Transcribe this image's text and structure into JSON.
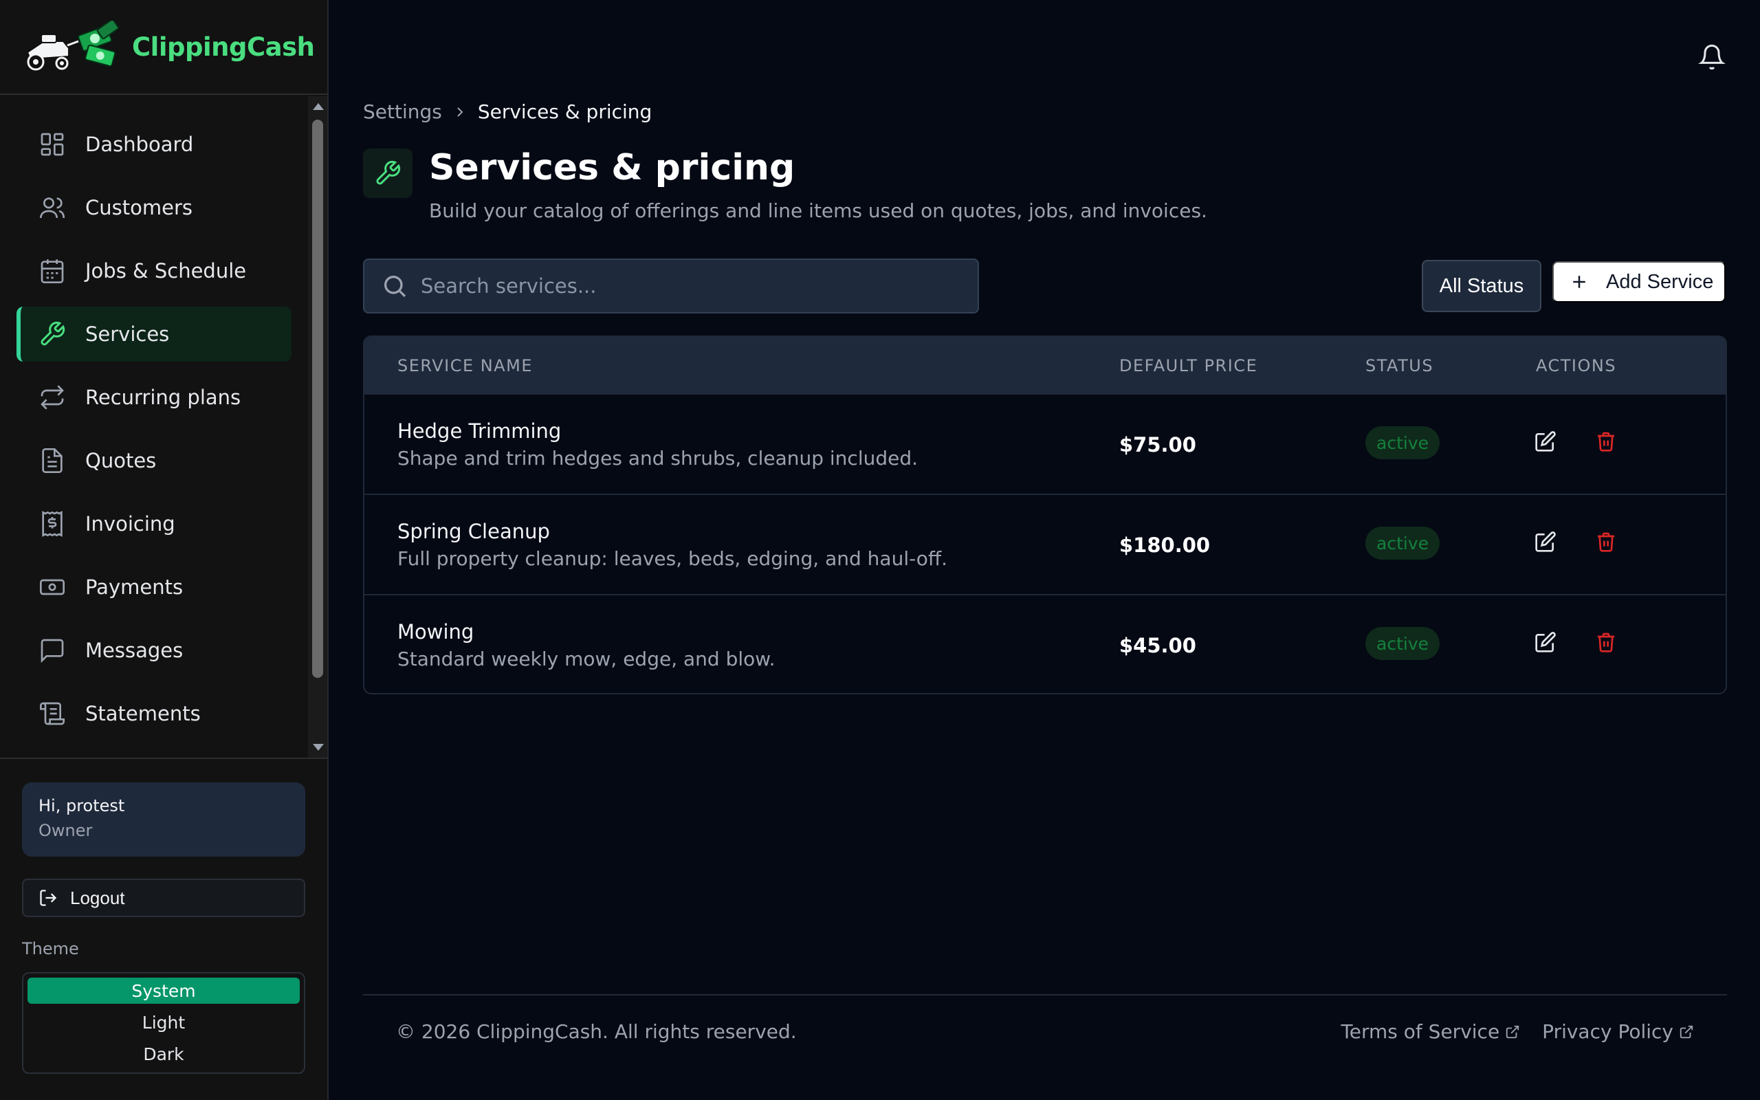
{
  "brand": {
    "name": "ClippingCash",
    "logo_icon": "lawnmower-money-logo"
  },
  "sidebar": {
    "items": [
      {
        "label": "Dashboard",
        "icon": "dashboard-icon"
      },
      {
        "label": "Customers",
        "icon": "users-icon"
      },
      {
        "label": "Jobs & Schedule",
        "icon": "calendar-icon"
      },
      {
        "label": "Services",
        "icon": "wrench-icon",
        "active": true
      },
      {
        "label": "Recurring plans",
        "icon": "repeat-icon"
      },
      {
        "label": "Quotes",
        "icon": "document-icon"
      },
      {
        "label": "Invoicing",
        "icon": "receipt-dollar-icon"
      },
      {
        "label": "Payments",
        "icon": "banknote-icon"
      },
      {
        "label": "Messages",
        "icon": "message-icon"
      },
      {
        "label": "Statements",
        "icon": "scroll-icon"
      }
    ],
    "user": {
      "greeting": "Hi, protest",
      "role": "Owner"
    },
    "logout_label": "Logout",
    "theme": {
      "label": "Theme",
      "options": [
        "System",
        "Light",
        "Dark"
      ],
      "selected": "System"
    }
  },
  "header": {
    "notification_icon": "bell-icon"
  },
  "breadcrumb": {
    "parent": "Settings",
    "current": "Services & pricing"
  },
  "page": {
    "title": "Services & pricing",
    "subtitle": "Build your catalog of offerings and line items used on quotes, jobs, and invoices."
  },
  "toolbar": {
    "search_placeholder": "Search services...",
    "search_value": "",
    "status_filter": "All Status",
    "add_label": "Add Service"
  },
  "table": {
    "headers": [
      "SERVICE NAME",
      "DEFAULT PRICE",
      "STATUS",
      "ACTIONS"
    ],
    "rows": [
      {
        "name": "Hedge Trimming",
        "description": "Shape and trim hedges and shrubs, cleanup included.",
        "price": "$75.00",
        "status": "active"
      },
      {
        "name": "Spring Cleanup",
        "description": "Full property cleanup: leaves, beds, edging, and haul-off.",
        "price": "$180.00",
        "status": "active"
      },
      {
        "name": "Mowing",
        "description": "Standard weekly mow, edge, and blow.",
        "price": "$45.00",
        "status": "active"
      }
    ]
  },
  "footer": {
    "copyright": "© 2026 ClippingCash. All rights reserved.",
    "links": [
      "Terms of Service",
      "Privacy Policy"
    ]
  },
  "colors": {
    "accent": "#4ade80",
    "active_bg": "#0d2418",
    "danger": "#dc2626",
    "theme_selected": "#059669"
  }
}
